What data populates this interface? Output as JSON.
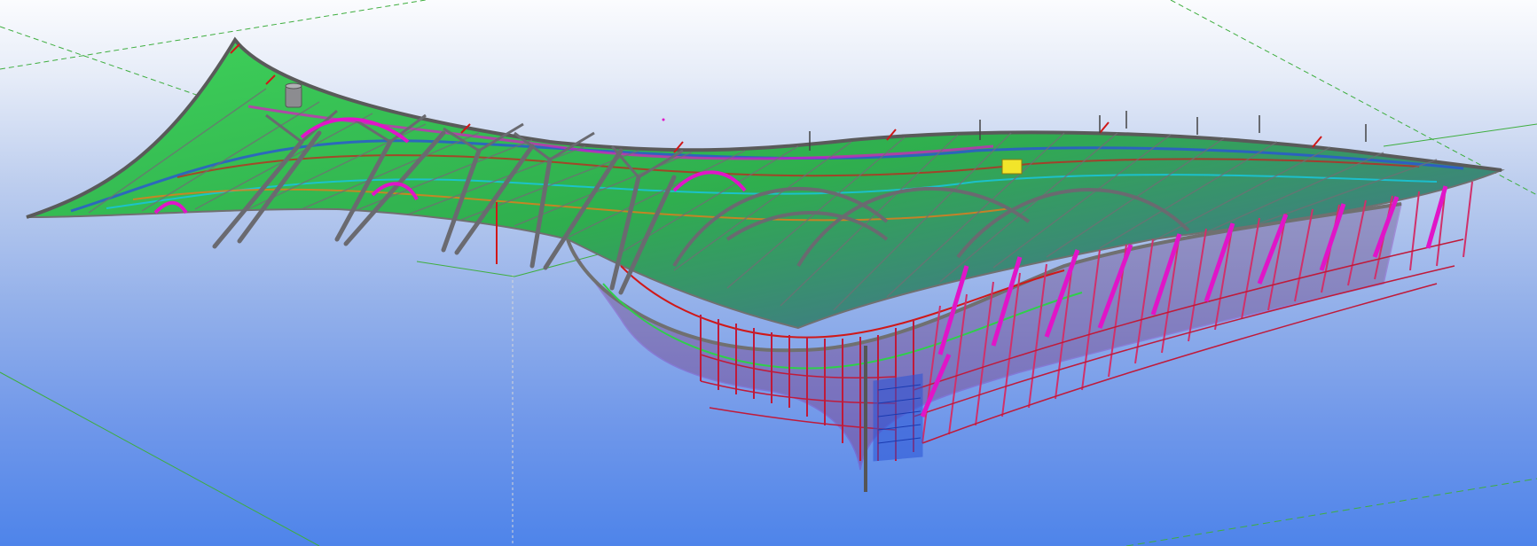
{
  "view": {
    "background_top": "#fbfcfe",
    "background_bottom": "#4e84ea",
    "grid_line_color": "#3fae3f",
    "grid_line_color_secondary": "#c8c8c8"
  },
  "model": {
    "member_colors": {
      "steel_gray": "#6f6f74",
      "primary_green": "#2fcf4a",
      "secondary_blue": "#2b54d6",
      "cyan_bracing": "#19c4d6",
      "red_members": "#d01818",
      "orange_members": "#e87a1a",
      "magenta_members": "#e015c8",
      "purple_members": "#8a2bb0",
      "highlight_yellow": "#f2e52a"
    },
    "icons": {
      "selected_object": "yellow-box-icon",
      "cylinder_object": "cylinder-icon"
    }
  }
}
